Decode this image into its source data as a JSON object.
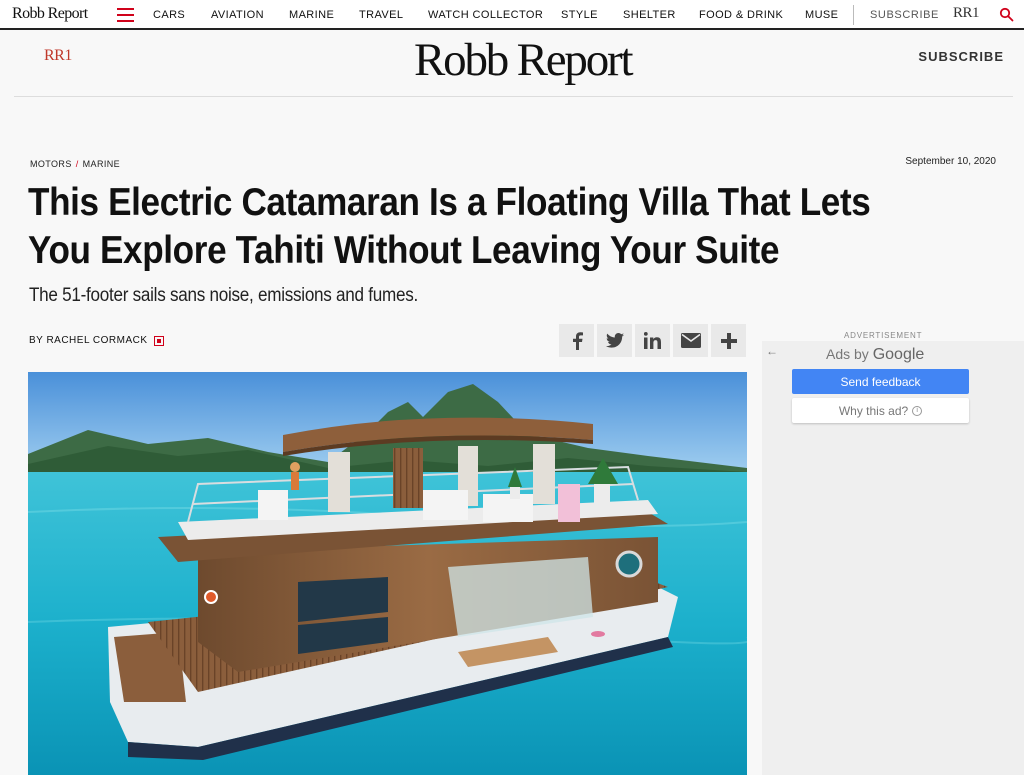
{
  "topnav": {
    "logo": "Robb Report",
    "items": [
      "CARS",
      "AVIATION",
      "MARINE",
      "TRAVEL",
      "WATCH COLLECTOR",
      "STYLE",
      "SHELTER",
      "FOOD & DRINK",
      "MUSE"
    ],
    "subscribe": "SUBSCRIBE",
    "rr1": "RR1"
  },
  "masthead": {
    "rr1": "RR1",
    "logo": "Robb Report",
    "subscribe": "SUBSCRIBE"
  },
  "article": {
    "breadcrumb": [
      "MOTORS",
      "MARINE"
    ],
    "breadcrumb_sep": "/",
    "date": "September 10, 2020",
    "title": "This Electric Catamaran Is a Floating Villa That Lets You Explore Tahiti Without Leaving Your Suite",
    "subtitle": "The 51-footer sails sans noise, emissions and fumes.",
    "byline": "BY RACHEL CORMACK"
  },
  "share": {
    "buttons": [
      {
        "name": "facebook",
        "icon": "facebook-icon"
      },
      {
        "name": "twitter",
        "icon": "twitter-icon"
      },
      {
        "name": "linkedin",
        "icon": "linkedin-icon"
      },
      {
        "name": "email",
        "icon": "email-icon"
      },
      {
        "name": "more",
        "icon": "plus-icon"
      }
    ]
  },
  "ad": {
    "label": "ADVERTISEMENT",
    "ads_by": "Ads by",
    "google": "Google",
    "feedback": "Send feedback",
    "why": "Why this ad?",
    "info": "i"
  },
  "colors": {
    "accent": "#d0021b",
    "google_blue": "#4285f4"
  }
}
